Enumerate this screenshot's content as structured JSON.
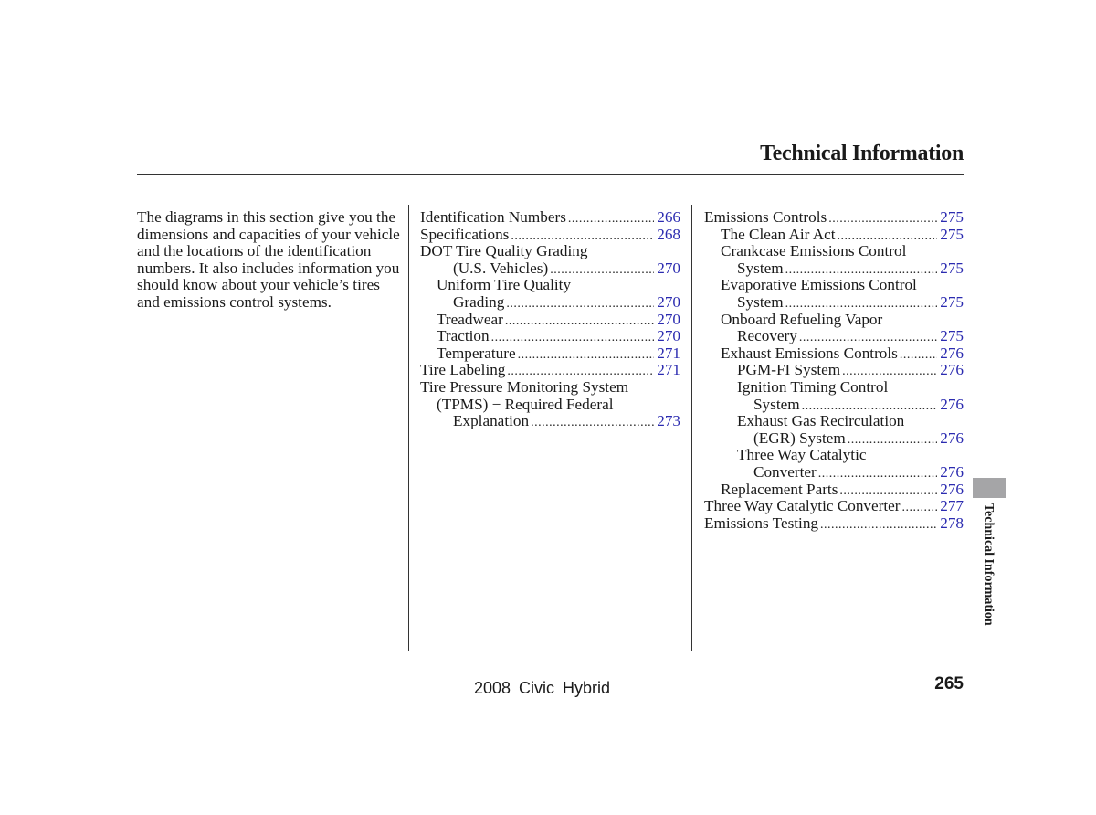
{
  "header": {
    "title": "Technical Information"
  },
  "intro": {
    "text": "The diagrams in this section give you the dimensions and capacities of your vehicle and the locations of the identification numbers. It also includes information you should know about your vehicle’s tires and emissions control systems."
  },
  "toc": {
    "column1": [
      {
        "lines": [
          "Identification Numbers"
        ],
        "page": "266",
        "indent": 0
      },
      {
        "lines": [
          "Specifications"
        ],
        "page": "268",
        "indent": 0
      },
      {
        "lines": [
          "DOT Tire Quality Grading",
          "(U.S. Vehicles)"
        ],
        "page": "270",
        "indent": 0,
        "cont_indent": 2
      },
      {
        "lines": [
          "Uniform Tire Quality",
          "Grading"
        ],
        "page": "270",
        "indent": 1,
        "cont_indent": 2
      },
      {
        "lines": [
          "Treadwear"
        ],
        "page": "270",
        "indent": 1
      },
      {
        "lines": [
          "Traction"
        ],
        "page": "270",
        "indent": 1
      },
      {
        "lines": [
          "Temperature"
        ],
        "page": "271",
        "indent": 1
      },
      {
        "lines": [
          "Tire Labeling"
        ],
        "page": "271",
        "indent": 0
      },
      {
        "lines": [
          "Tire Pressure Monitoring System",
          "(TPMS) − Required Federal",
          "Explanation"
        ],
        "page": "273",
        "indent": 0,
        "cont_indent": 1,
        "last_indent": 2
      }
    ],
    "column2": [
      {
        "lines": [
          "Emissions Controls"
        ],
        "page": "275",
        "indent": 0
      },
      {
        "lines": [
          "The Clean Air Act"
        ],
        "page": "275",
        "indent": 1
      },
      {
        "lines": [
          "Crankcase Emissions Control",
          "System"
        ],
        "page": "275",
        "indent": 1,
        "cont_indent": 2
      },
      {
        "lines": [
          "Evaporative Emissions Control",
          "System"
        ],
        "page": "275",
        "indent": 1,
        "cont_indent": 2
      },
      {
        "lines": [
          "Onboard Refueling Vapor",
          "Recovery"
        ],
        "page": "275",
        "indent": 1,
        "cont_indent": 2
      },
      {
        "lines": [
          "Exhaust Emissions Controls"
        ],
        "page": "276",
        "indent": 1
      },
      {
        "lines": [
          "PGM-FI System"
        ],
        "page": "276",
        "indent": 2
      },
      {
        "lines": [
          "Ignition Timing Control",
          "System"
        ],
        "page": "276",
        "indent": 2,
        "cont_indent": 3
      },
      {
        "lines": [
          "Exhaust Gas Recirculation",
          "(EGR) System"
        ],
        "page": "276",
        "indent": 2,
        "cont_indent": 3
      },
      {
        "lines": [
          "Three Way Catalytic",
          "Converter"
        ],
        "page": "276",
        "indent": 2,
        "cont_indent": 3
      },
      {
        "lines": [
          "Replacement Parts"
        ],
        "page": "276",
        "indent": 1
      },
      {
        "lines": [
          "Three Way Catalytic Converter"
        ],
        "page": "277",
        "indent": 0
      },
      {
        "lines": [
          "Emissions Testing"
        ],
        "page": "278",
        "indent": 0
      }
    ]
  },
  "side_tab": {
    "label": "Technical Information"
  },
  "footer": {
    "model": "2008  Civic  Hybrid",
    "page_number": "265"
  },
  "colors": {
    "link": "#2b2bb0",
    "tab": "#a5a5a7"
  }
}
